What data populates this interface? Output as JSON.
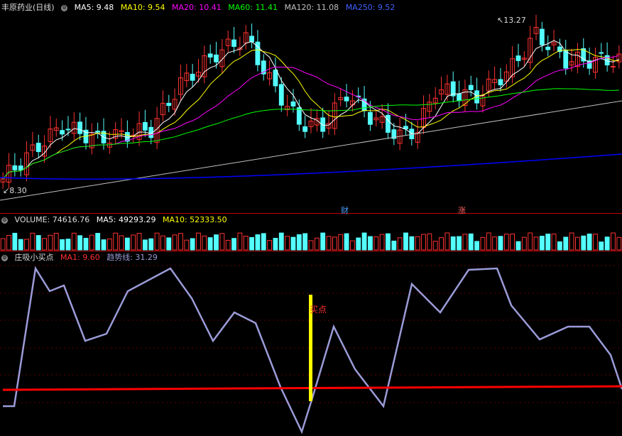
{
  "main": {
    "title": "丰原药业(日线)",
    "ma5": "MA5: 9.48",
    "ma10": "MA10: 9.54",
    "ma20": "MA20: 10.41",
    "ma60": "MA60: 11.41",
    "ma120": "MA120: 11.08",
    "ma250": "MA250: 9.52",
    "high_label": "13.27",
    "low_label": "8.30",
    "badge1": "财",
    "badge2": "涨"
  },
  "volume": {
    "title": "VOLUME: 74616.76",
    "ma5": "MA5: 49293.29",
    "ma10": "MA10: 52333.50"
  },
  "indicator": {
    "title": "庄吸小买点",
    "ma1": "MA1: 9.60",
    "trend": "趋势线: 31.29",
    "buy_label": "买点"
  },
  "colors": {
    "up": "#ff3232",
    "down": "#54ffff",
    "ma5": "#ffffff",
    "ma10": "#ffff00",
    "ma20": "#ff00ff",
    "ma60": "#00ff00",
    "ma120": "#c0c0c0",
    "ma250": "#0000ff",
    "trend": "#9b9bd8",
    "ma1": "#ff0000"
  }
}
